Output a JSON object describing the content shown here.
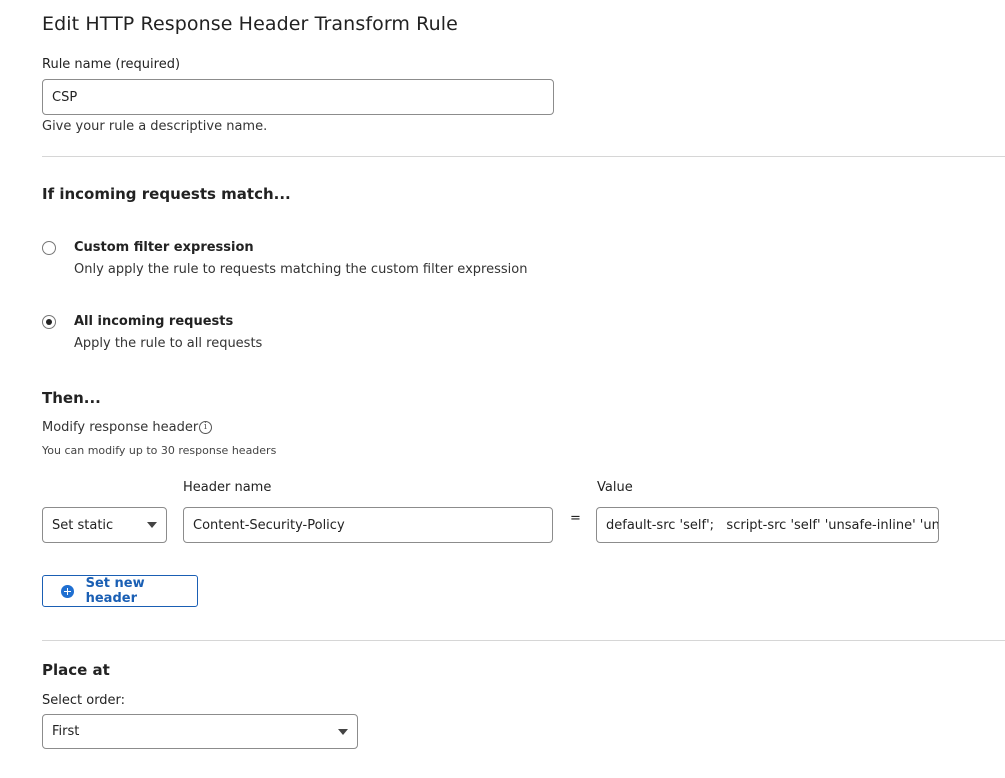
{
  "page": {
    "title": "Edit HTTP Response Header Transform Rule"
  },
  "rule_name": {
    "label": "Rule name (required)",
    "value": "CSP",
    "help": "Give your rule a descriptive name."
  },
  "match": {
    "heading": "If incoming requests match...",
    "options": [
      {
        "title": "Custom filter expression",
        "description": "Only apply the rule to requests matching the custom filter expression",
        "selected": false
      },
      {
        "title": "All incoming requests",
        "description": "Apply the rule to all requests",
        "selected": true
      }
    ]
  },
  "then": {
    "heading": "Then...",
    "modify_label": "Modify response header",
    "modify_help": "You can modify up to 30 response headers",
    "info_icon": "info-icon",
    "header_name_label": "Header name",
    "value_label": "Value",
    "operation": "Set static",
    "header_name": "Content-Security-Policy",
    "equals": "=",
    "value": "default-src 'self';   script-src 'self' 'unsafe-inline' 'unsaf",
    "add_button": "Set new header"
  },
  "place_at": {
    "heading": "Place at",
    "order_label": "Select order:",
    "order_value": "First"
  },
  "colors": {
    "accent": "#1a5fb4",
    "divider": "#d6d6d6",
    "input_border": "#8c8c8c"
  }
}
